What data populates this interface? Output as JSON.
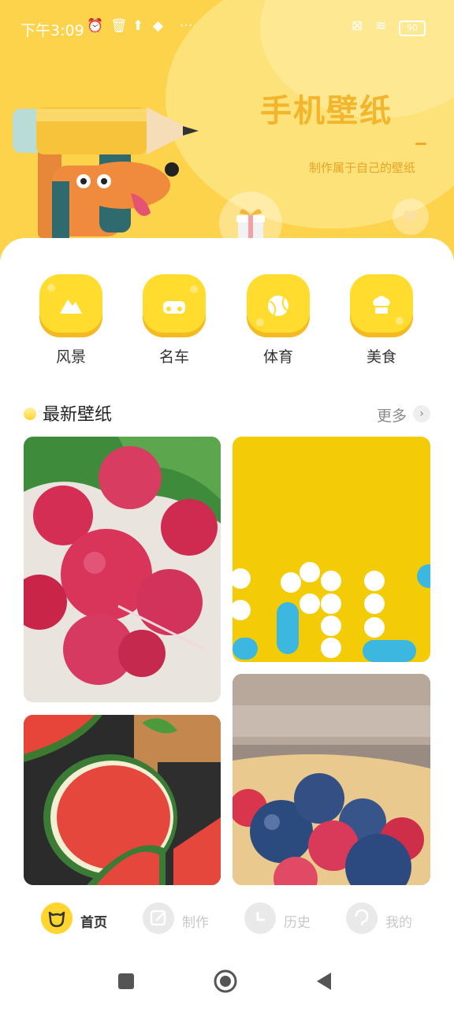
{
  "status_bar": {
    "time": "下午3:09",
    "battery": "90"
  },
  "hero": {
    "title": "手机壁纸",
    "subtitle": "制作属于自己的壁纸"
  },
  "categories": [
    {
      "label": "风景",
      "icon": "mountain-icon"
    },
    {
      "label": "名车",
      "icon": "car-icon"
    },
    {
      "label": "体育",
      "icon": "ball-icon"
    },
    {
      "label": "美食",
      "icon": "chef-hat-icon"
    }
  ],
  "section": {
    "title": "最新壁纸",
    "more": "更多"
  },
  "wallpapers": [
    {
      "subject": "radishes"
    },
    {
      "subject": "yellow-pills"
    },
    {
      "subject": "watermelon"
    },
    {
      "subject": "berries"
    }
  ],
  "bottom_nav": [
    {
      "label": "首页",
      "active": true,
      "icon": "bear-icon"
    },
    {
      "label": "制作",
      "active": false,
      "icon": "edit-icon"
    },
    {
      "label": "历史",
      "active": false,
      "icon": "clock-icon"
    },
    {
      "label": "我的",
      "active": false,
      "icon": "profile-icon"
    }
  ],
  "colors": {
    "accent": "#ffd52e",
    "hero_bg": "#fcd34b",
    "title": "#f2b52b"
  }
}
